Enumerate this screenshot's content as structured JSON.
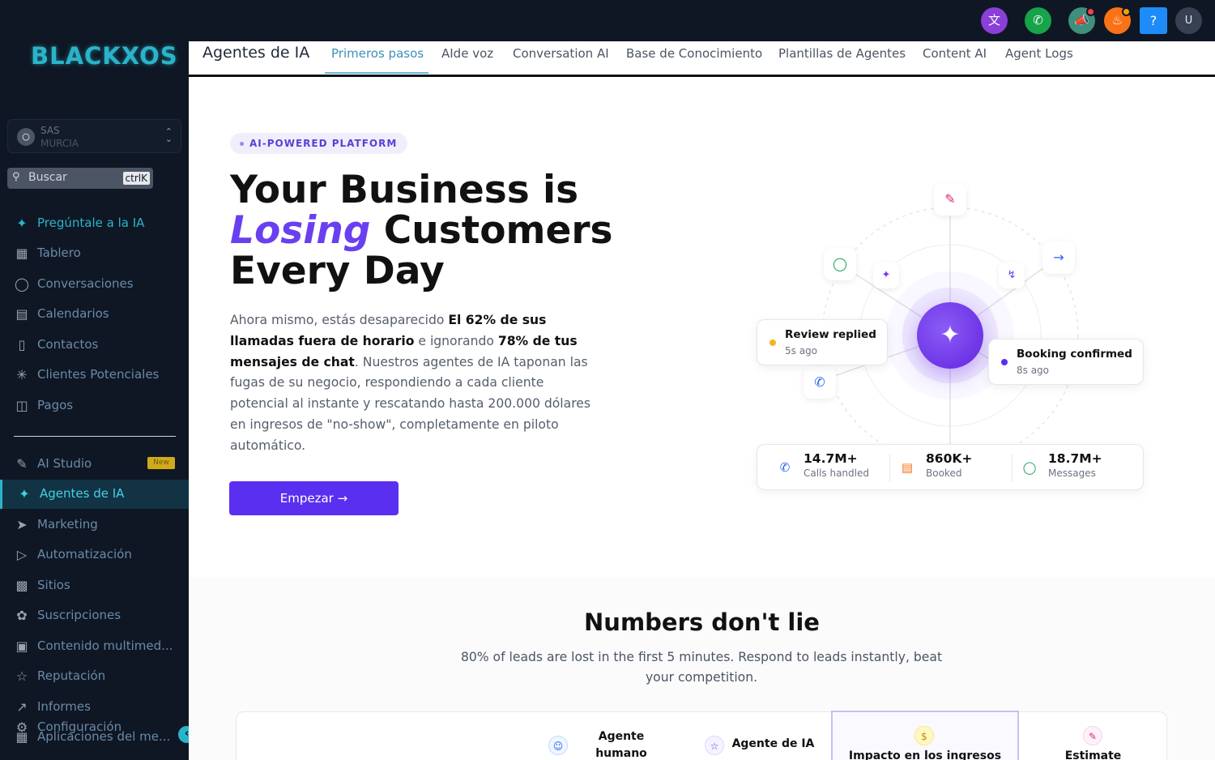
{
  "sidebar": {
    "logo": "BLACKXOS",
    "account": {
      "line1": "SAS",
      "line2": "MURCIA"
    },
    "search": {
      "placeholder": "Buscar",
      "shortcut": "ctrlK"
    },
    "items": [
      {
        "label": "Pregúntale a la IA",
        "icon": "sparkles-icon"
      },
      {
        "label": "Tablero",
        "icon": "grid-icon"
      },
      {
        "label": "Conversaciones",
        "icon": "chat-icon"
      },
      {
        "label": "Calendarios",
        "icon": "calendar-icon"
      },
      {
        "label": "Contactos",
        "icon": "contacts-icon"
      },
      {
        "label": "Clientes Potenciales",
        "icon": "network-icon"
      },
      {
        "label": "Pagos",
        "icon": "receipt-icon"
      },
      {
        "label": "AI Studio",
        "icon": "ai-studio-icon",
        "badge": "New"
      },
      {
        "label": "Agentes de IA",
        "icon": "agents-icon"
      },
      {
        "label": "Marketing",
        "icon": "send-icon"
      },
      {
        "label": "Automatización",
        "icon": "automation-icon"
      },
      {
        "label": "Sitios",
        "icon": "sites-icon"
      },
      {
        "label": "Suscripciones",
        "icon": "badge-icon"
      },
      {
        "label": "Contenido multimed...",
        "icon": "image-icon"
      },
      {
        "label": "Reputación",
        "icon": "star-icon"
      },
      {
        "label": "Informes",
        "icon": "trend-icon"
      },
      {
        "label": "Aplicaciones del me...",
        "icon": "apps-icon"
      },
      {
        "label": "Configuración",
        "icon": "gear-icon"
      }
    ]
  },
  "topbar": {
    "colors": {
      "translate": "#8b3fd9",
      "phone": "#16a34a",
      "megaphone": "#3f8f7a",
      "bell": "#f97316",
      "help": "#1d8cf8"
    },
    "help_label": "?",
    "user_initials": "U"
  },
  "tabs": {
    "title": "Agentes de IA",
    "items": [
      "Primeros pasos",
      "AIde voz",
      "Conversation AI",
      "Base de Conocimiento",
      "Plantillas de Agentes",
      "Content AI",
      "Agent Logs"
    ],
    "active": "Primeros pasos"
  },
  "hero": {
    "pill": "AI-POWERED PLATFORM",
    "title_line1": "Your Business is",
    "title_accent": "Losing",
    "title_line2_rest": " Customers",
    "title_line3": "Every Day",
    "body_parts": [
      "Ahora mismo, estás desaparecido ",
      "El 62% de sus llamadas fuera de horario",
      " e ignorando ",
      "78% de tus mensajes de chat",
      ". Nuestros agentes de IA taponan las fugas de su negocio, respondiendo a cada cliente potencial al instante y rescatando hasta 200.000 dólares en ingresos de \"no-show\", completamente en piloto automático."
    ],
    "cta": "Empezar →"
  },
  "illustration": {
    "cards": [
      {
        "title": "Review replied",
        "time": "5s ago",
        "dot": "#f5b323"
      },
      {
        "title": "Booking confirmed",
        "time": "8s ago",
        "dot": "#5b2ff0"
      }
    ],
    "stats": [
      {
        "value": "14.7M+",
        "label": "Calls handled",
        "icon": "phone-icon"
      },
      {
        "value": "860K+",
        "label": "Booked",
        "icon": "calendar-icon"
      },
      {
        "value": "18.7M+",
        "label": "Messages",
        "icon": "chat-icon"
      }
    ]
  },
  "numbers": {
    "title": "Numbers don't lie",
    "subtitle": "80% of leads are lost in the first 5 minutes. Respond to leads instantly, beat your competition.",
    "columns": [
      {
        "label": "Agente humano",
        "icon": "person-icon"
      },
      {
        "label": "Agente de IA",
        "icon": "star-icon"
      },
      {
        "label": "Impacto en los ingresos",
        "icon": "dollar-icon"
      },
      {
        "label": "Estimate",
        "icon": "pencil-icon"
      }
    ]
  }
}
